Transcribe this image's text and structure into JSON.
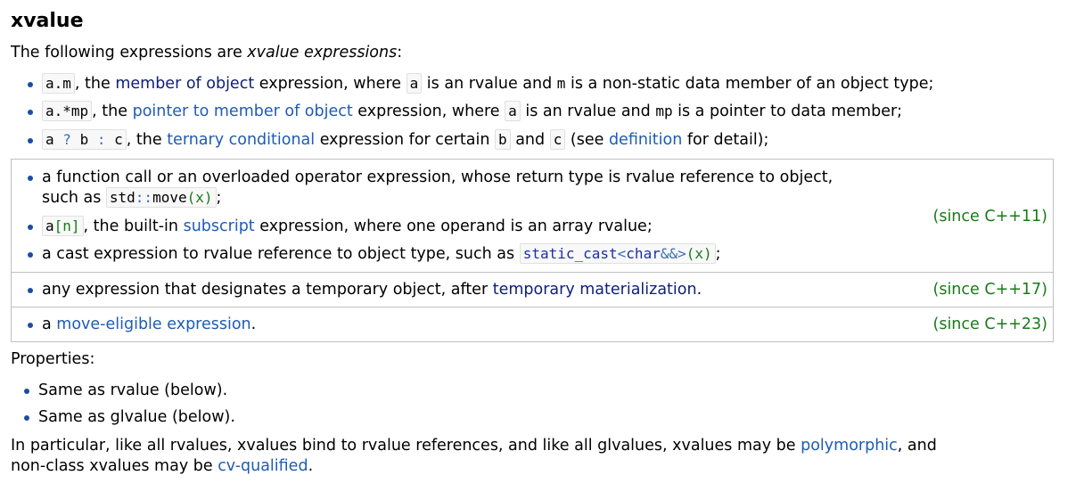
{
  "heading": "xvalue",
  "lead": {
    "text": "The following expressions are ",
    "emph": "xvalue expressions",
    "tail": ":"
  },
  "items": [
    {
      "code": "a.m",
      "t1": ", the ",
      "link": "member of object",
      "t2": " expression, where ",
      "code2": "a",
      "t3": " is an rvalue and ",
      "code3": "m",
      "t4": " is a non-static data member of an object type;"
    },
    {
      "code": "a.*mp",
      "t1": ", the ",
      "link": "pointer to member of object",
      "t2": " expression, where ",
      "code2": "a",
      "t3": " is an rvalue and ",
      "code3": "mp",
      "t4": " is a pointer to data member;"
    },
    {
      "code_a": "a",
      "code_q": "?",
      "code_b": "b",
      "code_c": ":",
      "code_d": "c",
      "t1": ", the ",
      "link": "ternary conditional",
      "t2": " expression for certain ",
      "code2": "b",
      "t3": " and ",
      "code3": "c",
      "t4": " (see ",
      "link2": "definition",
      "t5": " for detail);"
    }
  ],
  "rev1": {
    "since": "(since C++11)",
    "fcall_line1": "a function call or an overloaded operator expression, whose return type is rvalue reference to object,",
    "fcall_line2_pre": "such as ",
    "fcall_code_std": "std",
    "fcall_code_sep": "::",
    "fcall_code_fn": "move",
    "fcall_code_args": "(x)",
    "fcall_tail": ";",
    "sub_code": "a[n]",
    "sub_t1": ", the built-in ",
    "sub_link": "subscript",
    "sub_t2": " expression, where one operand is an array rvalue;",
    "cast_pre": "a cast expression to rvalue reference to object type, such as ",
    "cast_kw": "static_cast",
    "cast_lt": "<",
    "cast_type": "char",
    "cast_ref": "&&",
    "cast_gt": ">",
    "cast_args": "(x)",
    "cast_tail": ";"
  },
  "rev2": {
    "since": "(since C++17)",
    "pre": "any expression that designates a temporary object, after ",
    "link": "temporary materialization",
    "tail": "."
  },
  "rev3": {
    "since": "(since C++23)",
    "pre": "a ",
    "link": "move-eligible expression",
    "tail": "."
  },
  "properties": {
    "label": "Properties:",
    "items": [
      "Same as rvalue (below).",
      "Same as glvalue (below)."
    ]
  },
  "closing": {
    "line1_pre": "In particular, like all rvalues, xvalues bind to rvalue references, and like all glvalues, xvalues may be ",
    "link1": "polymorphic",
    "line1_tail": ", and",
    "line2_pre": "non-class xvalues may be ",
    "link2": "cv-qualified",
    "line2_tail": "."
  }
}
